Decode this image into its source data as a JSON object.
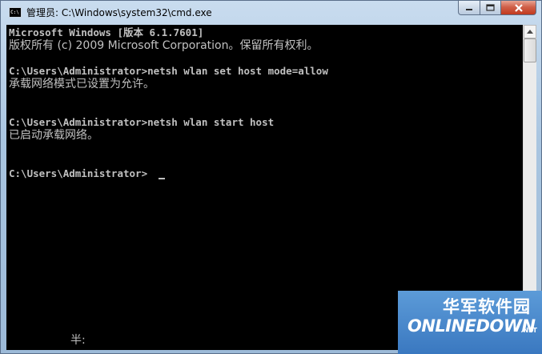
{
  "window": {
    "title": "管理员: C:\\Windows\\system32\\cmd.exe",
    "icon": "cmd-icon",
    "controls": {
      "minimize": "minimize-icon",
      "maximize": "maximize-icon",
      "close": "close-icon"
    }
  },
  "console": {
    "lines": [
      "Microsoft Windows [版本 6.1.7601]",
      "版权所有 (c) 2009 Microsoft Corporation。保留所有权利。",
      "",
      "C:\\Users\\Administrator>netsh wlan set host mode=allow",
      "承载网络模式已设置为允许。",
      "",
      "",
      "C:\\Users\\Administrator>netsh wlan start host",
      "已启动承载网络。",
      "",
      "",
      "C:\\Users\\Administrator>"
    ],
    "ime_status": "半:"
  },
  "watermark": {
    "cn": "华军软件园",
    "en": "ONLINEDOWN",
    "suffix": ".NET"
  },
  "colors": {
    "console_bg": "#000000",
    "console_fg": "#c0c0c0",
    "close_button": "#c1391e",
    "watermark_bg": "#3a78c0"
  }
}
